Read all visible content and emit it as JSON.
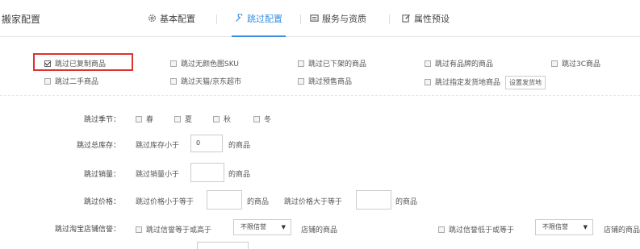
{
  "header": {
    "title": "搬家配置",
    "tabs": [
      {
        "label": "基本配置",
        "icon": "gear-icon"
      },
      {
        "label": "跳过配置",
        "icon": "wrench-icon"
      },
      {
        "label": "服务与资质",
        "icon": "card-icon"
      },
      {
        "label": "属性预设",
        "icon": "edit-icon"
      }
    ],
    "active_tab": "跳过配置"
  },
  "skip_options": [
    {
      "label": "跳过已复制商品",
      "checked": true
    },
    {
      "label": "跳过无颜色图SKU",
      "checked": false
    },
    {
      "label": "跳过已下架的商品",
      "checked": false
    },
    {
      "label": "跳过有品牌的商品",
      "checked": false
    },
    {
      "label": "跳过3C商品",
      "checked": false
    },
    {
      "label": "跳过二手商品",
      "checked": false
    },
    {
      "label": "跳过天猫/京东超市",
      "checked": false
    },
    {
      "label": "跳过预售商品",
      "checked": false
    },
    {
      "label": "跳过指定发货地商品",
      "checked": false
    }
  ],
  "set_ship_button": "设置发货地",
  "season": {
    "label": "跳过季节：",
    "options": [
      "春",
      "夏",
      "秋",
      "冬"
    ]
  },
  "stock": {
    "label": "跳过总库存：",
    "prefix": "跳过库存小于",
    "value": "0",
    "suffix": "的商品"
  },
  "sales": {
    "label": "跳过销量：",
    "prefix": "跳过销量小于",
    "value": "",
    "suffix": "的商品"
  },
  "price": {
    "label": "跳过价格：",
    "min_prefix": "跳过价格小于等于",
    "min_value": "",
    "min_suffix": "的商品",
    "max_prefix": "跳过价格大于等于",
    "max_value": "",
    "max_suffix": "的商品"
  },
  "credit": {
    "label": "跳过淘宝店铺信誉：",
    "high_label": "跳过信誉等于或高于",
    "high_select": "不限信誉",
    "high_suffix": "店铺的商品",
    "low_label": "跳过信誉低于或等于",
    "low_select": "不限信誉",
    "low_suffix": "店铺的商品"
  },
  "colors": {
    "accent": "#3b8fe0",
    "highlight_box": "#e0332d"
  }
}
